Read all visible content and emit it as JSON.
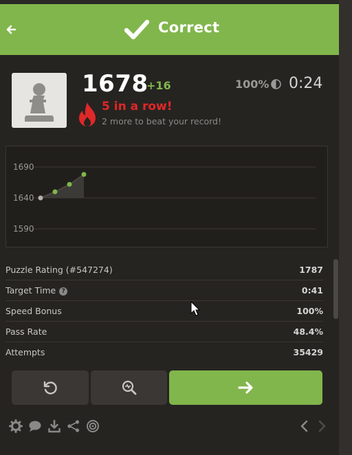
{
  "header": {
    "title": "Correct",
    "color": "#81b64c"
  },
  "player": {
    "rating": "1678",
    "rating_delta": "+16",
    "accuracy": "100%",
    "timer": "0:24",
    "streak": "5 in a row!",
    "streak_sub": "2 more to beat your record!"
  },
  "chart_data": {
    "type": "line",
    "y_ticks": [
      "1690",
      "1640",
      "1590"
    ],
    "ylim": [
      1590,
      1690
    ],
    "values": [
      1640,
      1650,
      1662,
      1678
    ],
    "series_color": "#81b64c"
  },
  "stats": [
    {
      "label": "Puzzle Rating (#547274)",
      "value": "1787"
    },
    {
      "label": "Target Time",
      "value": "0:41",
      "help": true
    },
    {
      "label": "Speed Bonus",
      "value": "100%"
    },
    {
      "label": "Pass Rate",
      "value": "48.4%"
    },
    {
      "label": "Attempts",
      "value": "35429"
    }
  ],
  "icons": {
    "back": "arrow-left-icon",
    "check": "checkmark-icon",
    "retry": "retry-icon",
    "analyze": "analysis-icon",
    "next": "arrow-right-icon",
    "settings": "gear-icon",
    "chat": "chat-icon",
    "download": "download-icon",
    "share": "share-icon",
    "target": "target-icon",
    "prev_nav": "chevron-left-icon",
    "next_nav": "chevron-right-icon"
  }
}
